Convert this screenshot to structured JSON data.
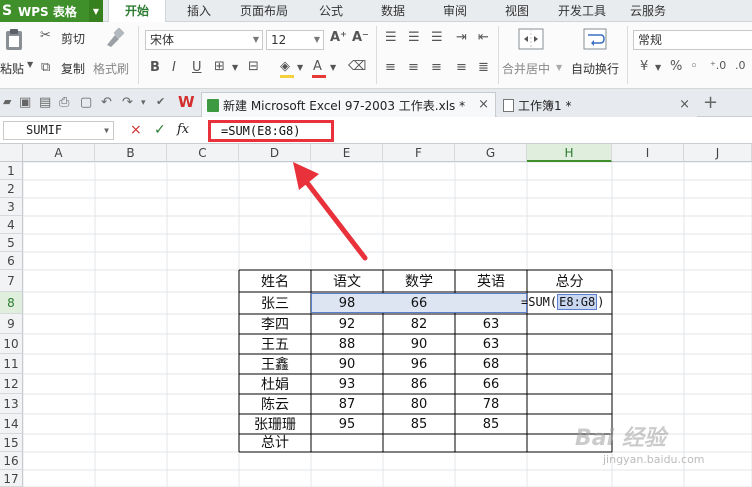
{
  "app": {
    "logo": "S",
    "title": "WPS 表格"
  },
  "menu": [
    "开始",
    "插入",
    "页面布局",
    "公式",
    "数据",
    "审阅",
    "视图",
    "开发工具",
    "云服务"
  ],
  "ribbon": {
    "paste": "粘贴",
    "cut": "剪切",
    "copy": "复制",
    "format_painter": "格式刷",
    "font_name": "宋体",
    "font_size": "12",
    "merge_center": "合并居中",
    "wrap_text": "自动换行",
    "number_format": "常规"
  },
  "tabs": [
    {
      "label": "新建 Microsoft Excel 97-2003 工作表.xls *",
      "close": "×"
    },
    {
      "label": "工作簿1 *",
      "close": "×"
    }
  ],
  "tabs_extra": {
    "new_tab": "+",
    "chevrons": "«"
  },
  "formula_bar": {
    "name_box": "SUMIF",
    "cancel": "×",
    "confirm": "✓",
    "fx": "fx",
    "formula": "=SUM(E8:G8)"
  },
  "columns": [
    "A",
    "B",
    "C",
    "D",
    "E",
    "F",
    "G",
    "H",
    "I",
    "J"
  ],
  "rows": [
    "1",
    "2",
    "3",
    "4",
    "5",
    "6",
    "7",
    "8",
    "9",
    "10",
    "11",
    "12",
    "13",
    "14",
    "15",
    "16",
    "17"
  ],
  "table": {
    "headers": [
      "姓名",
      "语文",
      "数学",
      "英语",
      "总分"
    ],
    "rows": [
      {
        "name": "张三",
        "chinese": "98",
        "math": "66",
        "english": "",
        "total": ""
      },
      {
        "name": "李四",
        "chinese": "92",
        "math": "82",
        "english": "63",
        "total": ""
      },
      {
        "name": "王五",
        "chinese": "88",
        "math": "90",
        "english": "63",
        "total": ""
      },
      {
        "name": "王鑫",
        "chinese": "90",
        "math": "96",
        "english": "68",
        "total": ""
      },
      {
        "name": "杜娟",
        "chinese": "93",
        "math": "86",
        "english": "66",
        "total": ""
      },
      {
        "name": "陈云",
        "chinese": "87",
        "math": "80",
        "english": "78",
        "total": ""
      },
      {
        "name": "张珊珊",
        "chinese": "95",
        "math": "85",
        "english": "85",
        "total": ""
      }
    ],
    "footer": "总计"
  },
  "editing": {
    "prefix": "=SUM(",
    "ref": "E8:G8",
    "suffix": ")"
  },
  "watermark": {
    "brand": "Bai 经验",
    "url": "jingyan.baidu.com"
  },
  "colors": {
    "accent": "#3f8f2b",
    "annotation": "#e8313a",
    "selection": "#dde5f3"
  }
}
